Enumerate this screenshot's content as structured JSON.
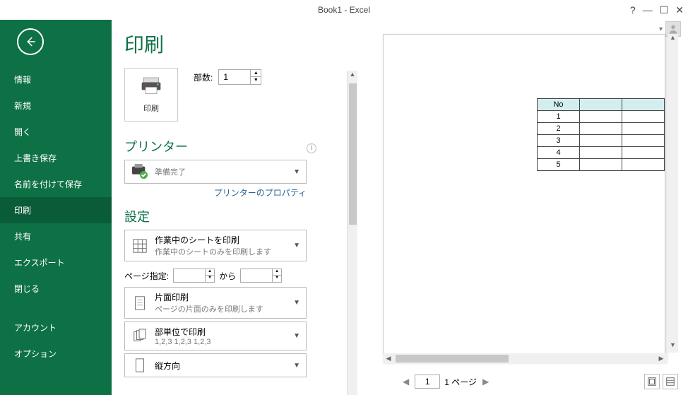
{
  "window": {
    "title": "Book1 - Excel"
  },
  "sidebar": {
    "items": [
      "情報",
      "新規",
      "開く",
      "上書き保存",
      "名前を付けて保存",
      "印刷",
      "共有",
      "エクスポート",
      "閉じる"
    ],
    "bottom": [
      "アカウント",
      "オプション"
    ],
    "active_index": 5
  },
  "print": {
    "title": "印刷",
    "button_label": "印刷",
    "copies_label": "部数:",
    "copies_value": "1"
  },
  "printer": {
    "section_title": "プリンター",
    "status": "準備完了",
    "properties_link": "プリンターのプロパティ"
  },
  "settings": {
    "section_title": "設定",
    "what_to_print": {
      "title": "作業中のシートを印刷",
      "sub": "作業中のシートのみを印刷します"
    },
    "page_range_label": "ページ指定:",
    "page_range_to": "から",
    "page_range_from_value": "",
    "page_range_to_value": "",
    "sides": {
      "title": "片面印刷",
      "sub": "ページの片面のみを印刷します"
    },
    "collate": {
      "title": "部単位で印刷",
      "sub": "1,2,3    1,2,3    1,2,3"
    },
    "orientation": {
      "title": "縦方向"
    }
  },
  "preview": {
    "table": {
      "header": [
        "No",
        "",
        ""
      ],
      "rows": [
        [
          "1",
          "",
          ""
        ],
        [
          "2",
          "",
          ""
        ],
        [
          "3",
          "",
          ""
        ],
        [
          "4",
          "",
          ""
        ],
        [
          "5",
          "",
          ""
        ]
      ]
    },
    "current_page": "1",
    "total_pages_label": "1 ページ"
  }
}
